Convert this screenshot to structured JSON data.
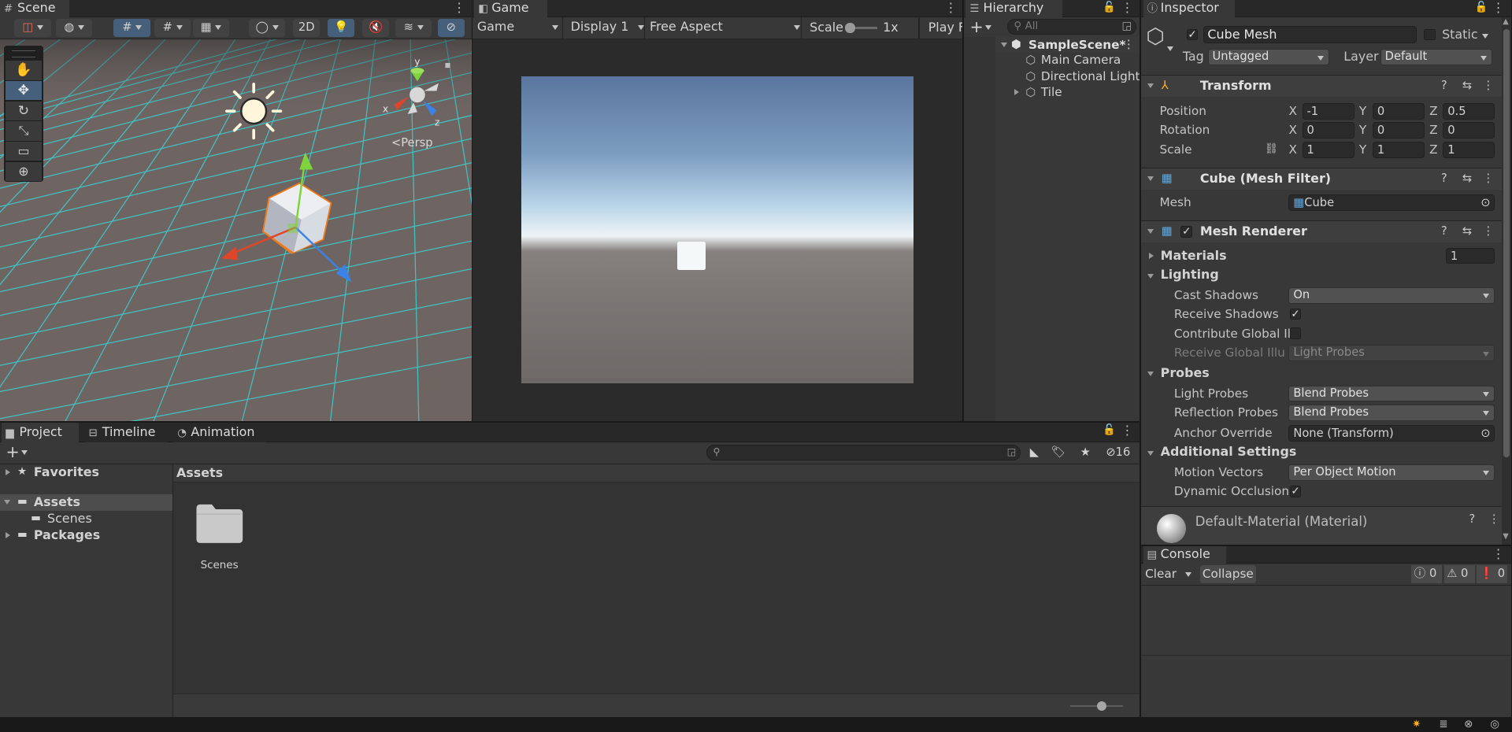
{
  "scene_panel": {
    "tab": "Scene",
    "toolbar": {
      "mode_2d": "2D"
    },
    "persp": "<Persp",
    "gizmo_axes": {
      "x": "x",
      "y": "y",
      "z": "z"
    }
  },
  "game_panel": {
    "tab": "Game",
    "display_mode": "Game",
    "display": "Display 1",
    "aspect": "Free Aspect",
    "scale_label": "Scale",
    "scale_value": "1x",
    "play_focused": "Play F"
  },
  "hierarchy": {
    "tab": "Hierarchy",
    "search_placeholder": "All",
    "items": [
      {
        "label": "SampleScene*"
      },
      {
        "label": "Main Camera"
      },
      {
        "label": "Directional Light"
      },
      {
        "label": "Tile"
      }
    ]
  },
  "inspector": {
    "tab": "Inspector",
    "object_name": "Cube Mesh",
    "static_label": "Static",
    "tag_label": "Tag",
    "tag_value": "Untagged",
    "layer_label": "Layer",
    "layer_value": "Default",
    "transform": {
      "title": "Transform",
      "position_label": "Position",
      "rotation_label": "Rotation",
      "scale_label": "Scale",
      "axis_x": "X",
      "axis_y": "Y",
      "axis_z": "Z",
      "position": {
        "x": "-1",
        "y": "0",
        "z": "0.5"
      },
      "rotation": {
        "x": "0",
        "y": "0",
        "z": "0"
      },
      "scale": {
        "x": "1",
        "y": "1",
        "z": "1"
      }
    },
    "mesh_filter": {
      "title": "Cube (Mesh Filter)",
      "mesh_label": "Mesh",
      "mesh_value": "Cube"
    },
    "mesh_renderer": {
      "title": "Mesh Renderer",
      "materials_label": "Materials",
      "materials_count": "1",
      "lighting_label": "Lighting",
      "cast_shadows_label": "Cast Shadows",
      "cast_shadows_value": "On",
      "receive_shadows_label": "Receive Shadows",
      "contribute_gi_label": "Contribute Global Ill",
      "receive_gi_label": "Receive Global Illun",
      "receive_gi_value": "Light Probes",
      "probes_label": "Probes",
      "light_probes_label": "Light Probes",
      "light_probes_value": "Blend Probes",
      "reflection_probes_label": "Reflection Probes",
      "reflection_probes_value": "Blend Probes",
      "anchor_override_label": "Anchor Override",
      "anchor_override_value": "None (Transform)",
      "additional_label": "Additional Settings",
      "motion_vectors_label": "Motion Vectors",
      "motion_vectors_value": "Per Object Motion",
      "dynamic_occlusion_label": "Dynamic Occlusion"
    },
    "material": {
      "title": "Default-Material (Material)"
    }
  },
  "project": {
    "tabs": {
      "project": "Project",
      "timeline": "Timeline",
      "animation": "Animation"
    },
    "hidden_count": "16",
    "tree": {
      "favorites": "Favorites",
      "assets": "Assets",
      "scenes": "Scenes",
      "packages": "Packages"
    },
    "breadcrumb": "Assets",
    "folder_label": "Scenes"
  },
  "console": {
    "tab": "Console",
    "clear": "Clear",
    "collapse": "Collapse",
    "info_count": "0",
    "warn_count": "0",
    "error_count": "0"
  },
  "colors": {
    "accent_select": "#2c5d87",
    "grid": "#3ad3d3",
    "axis_x": "#e0452a",
    "axis_y": "#7ed43a",
    "axis_z": "#3a82e6",
    "selection_outline": "#f07a1a"
  }
}
